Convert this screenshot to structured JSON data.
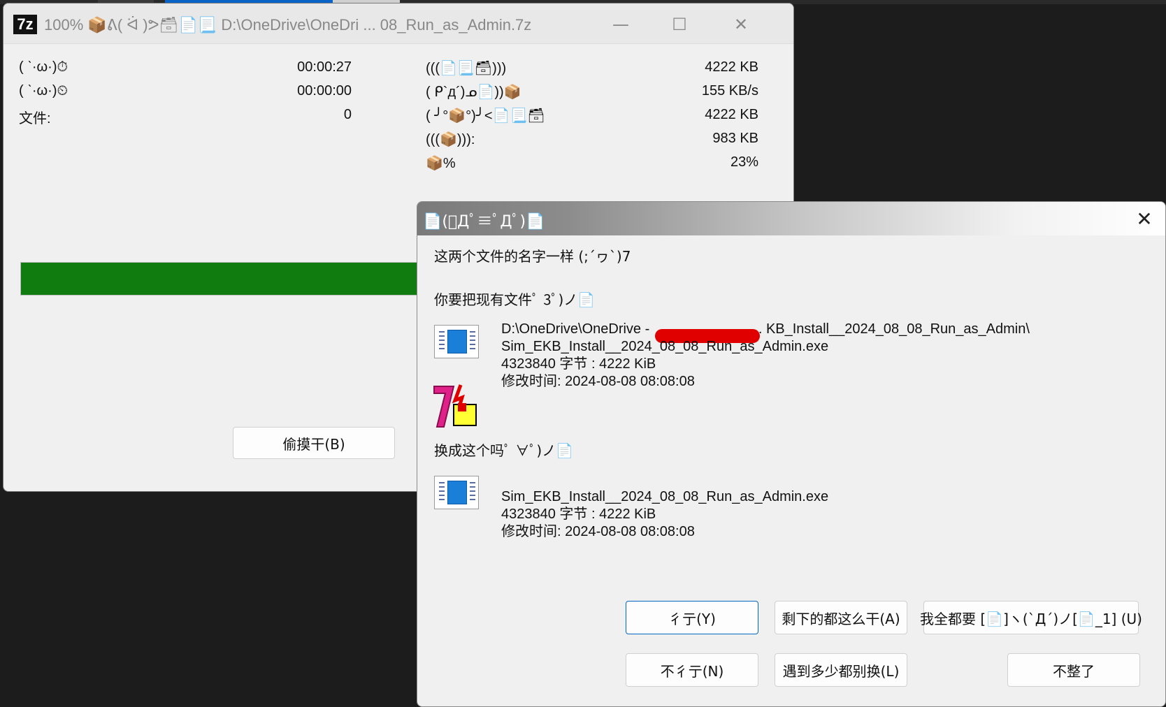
{
  "main_window": {
    "title": "100% 📦ᕕ( ᐛ )ᕗ🗃📄📃 D:\\OneDrive\\OneDri ... 08_Run_as_Admin.7z",
    "app_icon_label": "7z",
    "stats_left": [
      {
        "label": "( ˋ·ω·)⏱",
        "value": "00:00:27"
      },
      {
        "label": "( ˋ·ω·)⏲",
        "value": "00:00:00"
      },
      {
        "label": "文件:",
        "value": "0"
      }
    ],
    "stats_right": [
      {
        "label": "(((📄📃🗃)))",
        "value": "4222 KB"
      },
      {
        "label": "( ᑭ`д´)ᓄ📄))📦",
        "value": "155 KB/s"
      },
      {
        "label": "( ╯°📦°)╯<📄📃🗃",
        "value": "4222 KB"
      },
      {
        "label": "(((📦))):",
        "value": "983 KB"
      },
      {
        "label": "📦%",
        "value": "23%"
      }
    ],
    "progress_percent": 100,
    "background_button": "偷摸干(B)"
  },
  "dialog": {
    "title": "📄(ﾟДﾟ≡ﾟДﾟ)📄",
    "line1": "这两个文件的名字一样 (;´ヮ`)7",
    "line2": "你要把现有文件ﾟ 3ﾟ)ノ📄",
    "existing": {
      "path_start": "D:\\OneDrive\\OneDrive -",
      "path_end": ".. KB_Install__2024_08_08_Run_as_Admin\\",
      "name": "Sim_EKB_Install__2024_08_08_Run_as_Admin.exe",
      "size": "4323840 字节 : 4222 KiB",
      "modified": "修改时间: 2024-08-08 08:08:08"
    },
    "line3": "换成这个吗ﾟ ∀ﾟ)ノ📄",
    "incoming": {
      "name": "Sim_EKB_Install__2024_08_08_Run_as_Admin.exe",
      "size": "4323840 字节 : 4222 KiB",
      "modified": "修改时间: 2024-08-08 08:08:08"
    },
    "buttons": {
      "yes": "彳亍(Y)",
      "yes_all": "剩下的都这么干(A)",
      "rename_all": "我全都要 [📄]ヽ(`Д´)ノ[📄_1] (U)",
      "no": "不彳亍(N)",
      "no_all": "遇到多少都别换(L)",
      "cancel": "不整了"
    }
  }
}
